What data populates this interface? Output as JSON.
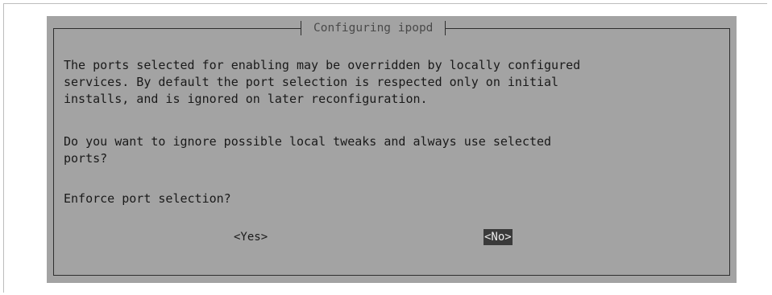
{
  "dialog": {
    "title": "Configuring ipopd",
    "description_lines": [
      "The ports selected for enabling may be overridden by locally configured",
      "services. By default the port selection is respected only on initial",
      "installs, and is ignored on later reconfiguration."
    ],
    "question_lines": [
      "Do you want to ignore possible local tweaks and always use selected",
      "ports?"
    ],
    "prompt": "Enforce port selection?",
    "buttons": {
      "yes_label": "<Yes>",
      "no_label": "<No>"
    }
  },
  "colors": {
    "dialog_background": "#a3a3a3",
    "border": "#2e2e2e",
    "text": "#1a1a1a",
    "selected_button_background": "#3a3a3a",
    "selected_button_text": "#ececec"
  }
}
